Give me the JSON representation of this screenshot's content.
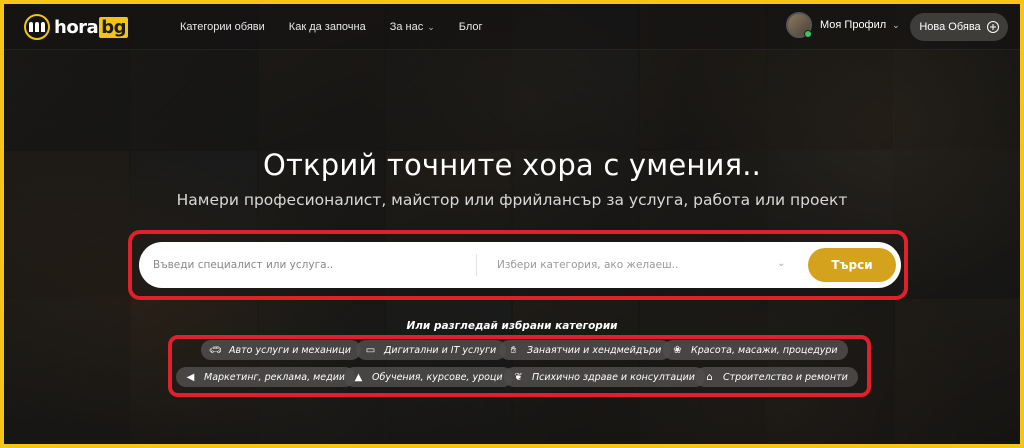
{
  "header": {
    "logo_text": "hora",
    "logo_domain": "bg",
    "nav": [
      {
        "label": "Категории обяви"
      },
      {
        "label": "Как да започна"
      },
      {
        "label": "За нас"
      },
      {
        "label": "Блог"
      }
    ],
    "profile_label": "Моя Профил",
    "new_ad_label": "Нова Обява"
  },
  "hero": {
    "title": "Открий точните хора с умения..",
    "subtitle": "Намери професионалист, майстор или фрийлансър за услуга, работа или проект"
  },
  "search": {
    "placeholder": "Въведи специалист или услуга..",
    "category_placeholder": "Избери категория, ако желаеш..",
    "button_label": "Търси"
  },
  "categories": {
    "heading": "Или разгледай избрани категории",
    "row1": [
      {
        "label": "Авто услуги и механици",
        "icon": "car-icon"
      },
      {
        "label": "Дигитални и IT услуги",
        "icon": "laptop-icon"
      },
      {
        "label": "Занаятчии и хендмейдъри",
        "icon": "hands-icon"
      },
      {
        "label": "Красота, масажи, процедури",
        "icon": "lotus-icon"
      }
    ],
    "row2": [
      {
        "label": "Маркетинг, реклама, медии",
        "icon": "megaphone-icon"
      },
      {
        "label": "Обучения, курсове, уроци",
        "icon": "graduation-cap-icon"
      },
      {
        "label": "Психично здраве и консултации",
        "icon": "brain-icon"
      },
      {
        "label": "Строителство и ремонти",
        "icon": "house-icon"
      }
    ]
  },
  "colors": {
    "accent": "#d4a21c",
    "highlight_border": "#e0202a",
    "frame": "#f5c518",
    "online_status": "#3ac46b"
  }
}
